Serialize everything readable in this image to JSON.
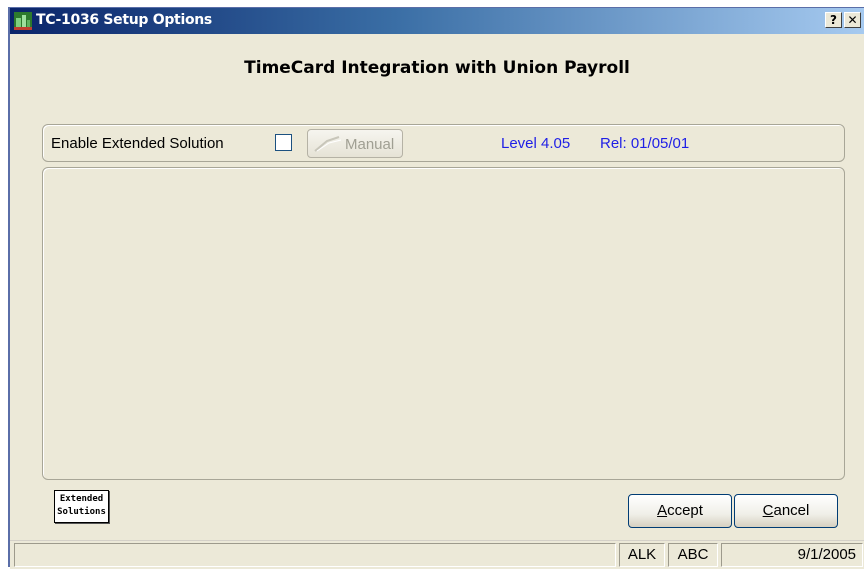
{
  "window": {
    "title": "TC-1036 Setup Options",
    "help_label": "?",
    "close_label": "✕"
  },
  "heading": "TimeCard Integration with Union Payroll",
  "options": {
    "enable_label": "Enable Extended Solution",
    "enable_checked": false,
    "manual_label": "Manual",
    "level": "Level 4.05",
    "release": "Rel: 01/05/01"
  },
  "logo": {
    "line1": "Extended",
    "line2": "Solutions"
  },
  "buttons": {
    "accept_mnemonic": "A",
    "accept_rest": "ccept",
    "cancel_mnemonic": "C",
    "cancel_rest": "ancel"
  },
  "status": {
    "message": "",
    "user": "ALK",
    "company": "ABC",
    "date": "9/1/2005"
  },
  "colors": {
    "accent_text": "#1f1fe6",
    "titlebar_start": "#0a246a",
    "window_bg": "#ece9d8"
  }
}
